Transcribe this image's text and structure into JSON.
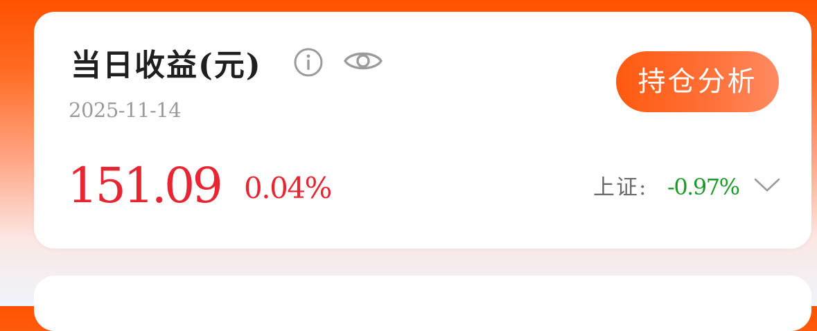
{
  "card": {
    "title": "当日收益(元)",
    "date": "2025-11-14",
    "action_button": "持仓分析",
    "profit_amount": "151.09",
    "profit_rate": "0.04%",
    "index_label": "上证:",
    "index_change": "-0.97%"
  },
  "icons": {
    "info": "info-icon",
    "visibility": "eye-icon",
    "expand": "chevron-down-icon"
  },
  "colors": {
    "accent": "#ff5a10",
    "profit_red": "#e62632",
    "loss_green": "#1a9a28",
    "muted": "#9a9a9a"
  }
}
